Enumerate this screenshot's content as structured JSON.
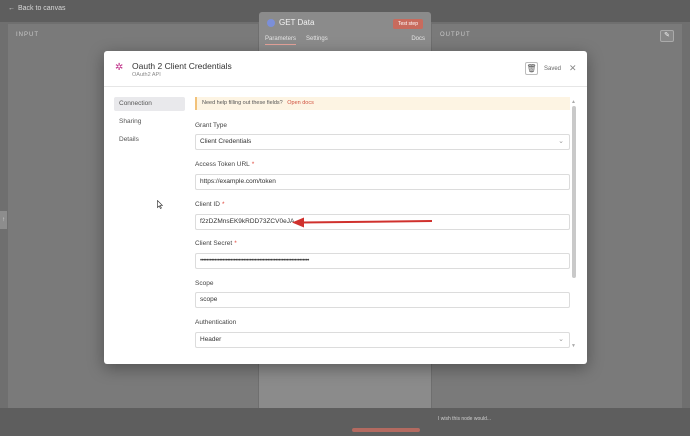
{
  "background": {
    "back_link": "Back to canvas",
    "input_label": "INPUT",
    "output_label": "OUTPUT",
    "node_title": "GET Data",
    "test_step": "Test step",
    "tabs": [
      "Parameters",
      "Settings"
    ],
    "docs": "Docs",
    "hint": "I wish this node would..."
  },
  "modal": {
    "title": "Oauth 2 Client Credentials",
    "subtitle": "OAuth2 API",
    "saved": "Saved",
    "sidebar": [
      "Connection",
      "Sharing",
      "Details"
    ],
    "notice_text": "Need help filling out these fields?",
    "notice_link": "Open docs",
    "fields": {
      "grant_type": {
        "label": "Grant Type",
        "value": "Client Credentials"
      },
      "access_token_url": {
        "label": "Access Token URL",
        "value": "https://example.com/token"
      },
      "client_id": {
        "label": "Client ID",
        "value": "f2zDZMnsEK9kRDD73ZCV0eJA"
      },
      "client_secret": {
        "label": "Client Secret",
        "value": "••••••••••••••••••••••••••••••••••••••••••••••••••••••••••••••••••••"
      },
      "scope": {
        "label": "Scope",
        "value": "scope"
      },
      "authentication": {
        "label": "Authentication",
        "value": "Header"
      }
    },
    "required_mark": "*"
  },
  "colors": {
    "accent": "#d0513f",
    "arrow": "#d0312d",
    "required": "#e0463a",
    "icon": "#c0328a"
  }
}
